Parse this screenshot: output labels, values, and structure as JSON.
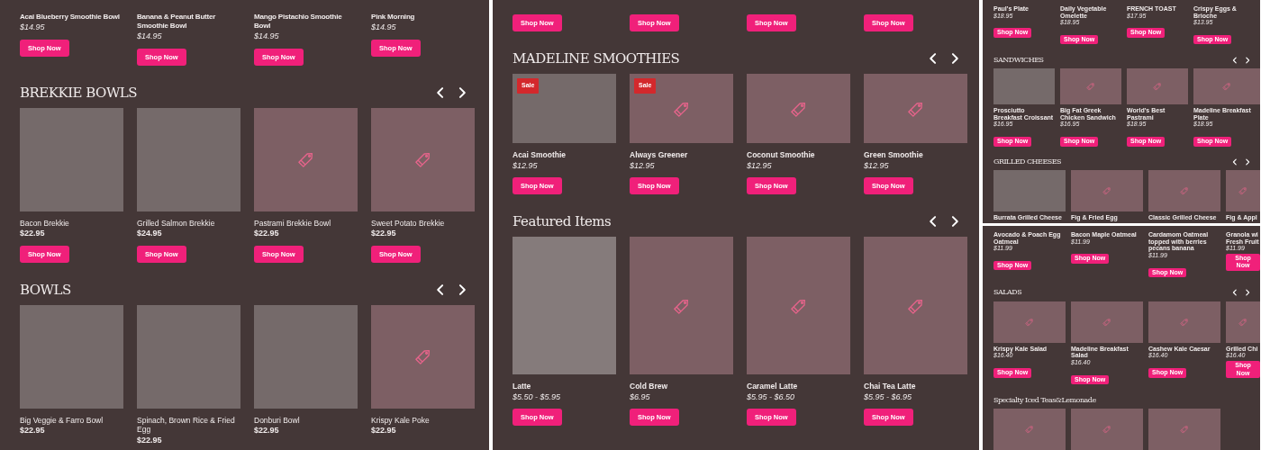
{
  "panels": [
    {
      "kind": "wide",
      "sections": [
        {
          "kind": "top",
          "products": [
            {
              "name": "Acai Blueberry Smoothie Bowl",
              "price": "$14.95",
              "button": "Shop Now"
            },
            {
              "name": "Banana & Peanut Butter Smoothie Bowl",
              "price": "$14.95",
              "button": "Shop Now"
            },
            {
              "name": "Mango Pistachio Smoothie Bowl",
              "price": "$14.95",
              "button": "Shop Now"
            },
            {
              "name": "Pink Morning",
              "price": "$14.95",
              "button": "Shop Now"
            }
          ]
        },
        {
          "title": "BREKKIE BOWLS",
          "arrows": true,
          "kind": "square",
          "products": [
            {
              "name": "Bacon Brekkie",
              "price": "$22.95",
              "button": "Shop Now",
              "kind": "plain"
            },
            {
              "name": "Grilled Salmon Brekkie",
              "price": "$24.95",
              "button": "Shop Now",
              "kind": "plain"
            },
            {
              "name": "Pastrami Brekkie Bowl",
              "price": "$22.95",
              "button": "Shop Now",
              "kind": "tag"
            },
            {
              "name": "Sweet Potato Brekkie",
              "price": "$22.95",
              "button": "Shop Now",
              "kind": "tag"
            }
          ]
        },
        {
          "title": "BOWLS",
          "arrows": true,
          "kind": "square",
          "products": [
            {
              "name": "Big Veggie & Farro Bowl",
              "price": "$22.95",
              "kind": "plain"
            },
            {
              "name": "Spinach, Brown Rice & Fried Egg",
              "price": "$22.95",
              "kind": "plain"
            },
            {
              "name": "Donburi Bowl",
              "price": "$22.95",
              "kind": "plain"
            },
            {
              "name": "Krispy Kale Poke",
              "price": "$22.95",
              "kind": "tag"
            }
          ]
        }
      ]
    },
    {
      "kind": "wide",
      "sections": [
        {
          "kind": "top",
          "products": [
            {
              "button": "Shop Now"
            },
            {
              "button": "Shop Now"
            },
            {
              "button": "Shop Now"
            },
            {
              "button": "Shop Now"
            }
          ]
        },
        {
          "title": "MADELINE SMOOTHIES",
          "arrows": true,
          "kind": "landscape",
          "products": [
            {
              "name": "Acai Smoothie",
              "price": "$12.95",
              "button": "Shop Now",
              "kind": "plain",
              "sale": "Sale"
            },
            {
              "name": "Always Greener",
              "price": "$12.95",
              "button": "Shop Now",
              "kind": "tag",
              "sale": "Sale"
            },
            {
              "name": "Coconut Smoothie",
              "price": "$12.95",
              "button": "Shop Now",
              "kind": "tag"
            },
            {
              "name": "Green Smoothie",
              "price": "$12.95",
              "button": "Shop Now",
              "kind": "tag"
            }
          ]
        },
        {
          "title": "Featured Items",
          "arrows": true,
          "kind": "portrait",
          "products": [
            {
              "name": "Latte",
              "price": "$5.50 - $5.95",
              "button": "Shop Now",
              "kind": "light"
            },
            {
              "name": "Cold Brew",
              "price": "$6.95",
              "button": "Shop Now",
              "kind": "tag"
            },
            {
              "name": "Caramel Latte",
              "price": "$5.95 - $6.50",
              "button": "Shop Now",
              "kind": "tag"
            },
            {
              "name": "Chai Tea Latte",
              "price": "$5.95 - $6.95",
              "button": "Shop Now",
              "kind": "tag"
            }
          ]
        }
      ]
    },
    {
      "kind": "compact",
      "sections": [
        {
          "kind": "narrowtop",
          "products": [
            {
              "name": "Paul's Plate",
              "price": "$18.95",
              "button": "Shop Now"
            },
            {
              "name": "Daily Vegetable Omelette",
              "price": "$18.95",
              "button": "Shop Now"
            },
            {
              "name": "FRENCH TOAST",
              "price": "$17.95",
              "button": "Shop Now"
            },
            {
              "name": "Crispy Eggs & Brioche",
              "price": "$13.95",
              "button": "Shop Now"
            }
          ]
        },
        {
          "title": "SANDWICHES",
          "arrows": true,
          "kind": "narrow",
          "products": [
            {
              "name": "Prosciutto Breakfast Croissant",
              "price": "$16.95",
              "button": "Shop Now",
              "kind": "plain"
            },
            {
              "name": "Big Fat Greek Chicken Sandwich",
              "price": "$16.95",
              "button": "Shop Now",
              "kind": "tag"
            },
            {
              "name": "World's Best Pastrami",
              "price": "$18.95",
              "button": "Shop Now",
              "kind": "tag"
            },
            {
              "name": "Madeline Breakfast Plate",
              "price": "$18.95",
              "button": "Shop Now",
              "kind": "tag"
            }
          ]
        },
        {
          "title": "GRILLED CHEESES",
          "arrows": true,
          "kind": "landscape",
          "products": [
            {
              "name": "Burrata Grilled Cheese",
              "kind": "plain"
            },
            {
              "name": "Fig & Fried Egg",
              "kind": "tag"
            },
            {
              "name": "Classic Grilled Cheese",
              "kind": "tag"
            },
            {
              "name": "Fig & Appl",
              "kind": "tag"
            }
          ]
        }
      ]
    },
    {
      "kind": "compact",
      "sections": [
        {
          "kind": "top",
          "products": [
            {
              "name": "Avocado & Poach Egg Oatmeal",
              "price": "$11.99",
              "button": "Shop Now"
            },
            {
              "name": "Bacon Maple Oatmeal",
              "price": "$11.99",
              "button": "Shop Now"
            },
            {
              "name": "Cardamom Oatmeal topped with berries pecans banana",
              "price": "$11.99",
              "button": "Shop Now"
            },
            {
              "name": "Granola wi Fresh Fruit",
              "price": "$11.99",
              "button": "Shop Now"
            }
          ]
        },
        {
          "title": "SALADS",
          "arrows": true,
          "kind": "landscape",
          "products": [
            {
              "name": "Krispy Kale Salad",
              "price": "$16.40",
              "button": "Shop Now",
              "kind": "tag"
            },
            {
              "name": "Madeline Breakfast Salad",
              "price": "$16.40",
              "button": "Shop Now",
              "kind": "tag"
            },
            {
              "name": "Cashew Kale Caesar",
              "price": "$16.40",
              "button": "Shop Now",
              "kind": "tag"
            },
            {
              "name": "Grilled Chi",
              "price": "$16.40",
              "button": "Shop Now",
              "kind": "tag"
            }
          ]
        },
        {
          "title": "Specialty Iced Teas&Lemonade",
          "arrows": false,
          "kind": "landscape",
          "products": [
            {
              "kind": "tag"
            },
            {
              "kind": "tag"
            },
            {
              "kind": "tag"
            }
          ]
        }
      ]
    }
  ]
}
